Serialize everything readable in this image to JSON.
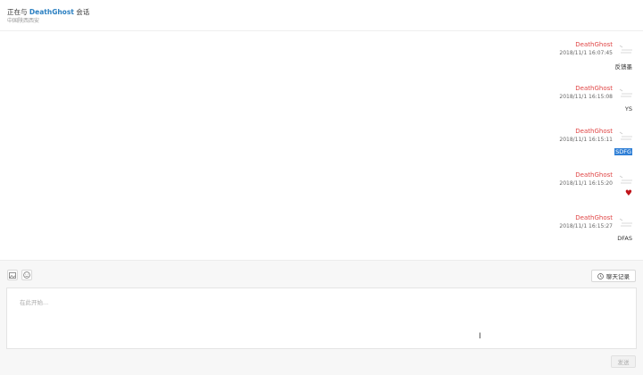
{
  "header": {
    "prefix": "正在与",
    "name": "DeathGhost",
    "suffix": "会话",
    "subtitle": "中国陕西西安"
  },
  "messages": [
    {
      "sender": "DeathGhost",
      "time": "2018/11/1 16:07:45",
      "content": "反馈墨",
      "style": "normal"
    },
    {
      "sender": "DeathGhost",
      "time": "2018/11/1 16:15:08",
      "content": "YS",
      "style": "normal"
    },
    {
      "sender": "DeathGhost",
      "time": "2018/11/1 16:15:11",
      "content": "SDFG",
      "style": "selected"
    },
    {
      "sender": "DeathGhost",
      "time": "2018/11/1 16:15:20",
      "content": "♥",
      "style": "heart"
    },
    {
      "sender": "DeathGhost",
      "time": "2018/11/1 16:15:27",
      "content": "DFAS",
      "style": "normal"
    }
  ],
  "toolbar": {
    "image_icon": "image-icon",
    "emoji_icon": "emoji-icon",
    "history_label": "聊天记录",
    "history_icon": "clock-icon"
  },
  "composer": {
    "placeholder": "在此开始...",
    "send_label": "发送"
  }
}
